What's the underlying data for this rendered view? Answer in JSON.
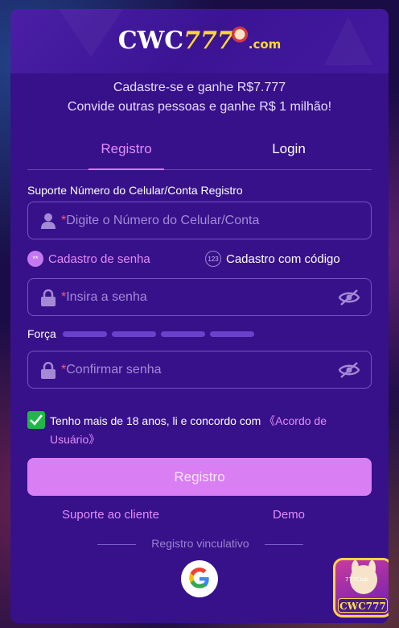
{
  "brand": {
    "logo_main": "CWC",
    "logo_num": "777",
    "logo_domain": ".com"
  },
  "promo": {
    "line1": "Cadastre-se e ganhe R$7.777",
    "line2": "Convide outras pessoas e ganhe R$ 1 milhão!"
  },
  "tabs": {
    "register": "Registro",
    "login": "Login",
    "active": "register"
  },
  "account_field": {
    "label": "Suporte Número do Celular/Conta Registro",
    "placeholder_star": "*",
    "placeholder": "Digite o Número do Celular/Conta"
  },
  "register_modes": {
    "password_mode": "Cadastro de senha",
    "password_mode_icon": "**",
    "code_mode": "Cadastro com código",
    "code_mode_icon": "123",
    "selected": "password_mode"
  },
  "password_field": {
    "placeholder_star": "*",
    "placeholder": "Insira a senha"
  },
  "strength": {
    "label": "Força",
    "level": 0
  },
  "confirm_field": {
    "placeholder_star": "*",
    "placeholder": "Confirmar senha"
  },
  "agreement": {
    "checked": true,
    "text": "Tenho mais de 18 anos, li e concordo com ",
    "link": "《Acordo de Usuário》"
  },
  "submit_label": "Registro",
  "links": {
    "support": "Suporte ao cliente",
    "demo": "Demo"
  },
  "social": {
    "divider_label": "Registro vinculativo",
    "google_icon": "google-icon"
  },
  "app_badge": {
    "label": "CWC777",
    "sublabel": "777Club"
  },
  "colors": {
    "modal_bg": "#37118a",
    "accent": "#e38cf6",
    "button": "#d97ef3",
    "check": "#1fb848",
    "logo_yellow": "#ffd733"
  }
}
